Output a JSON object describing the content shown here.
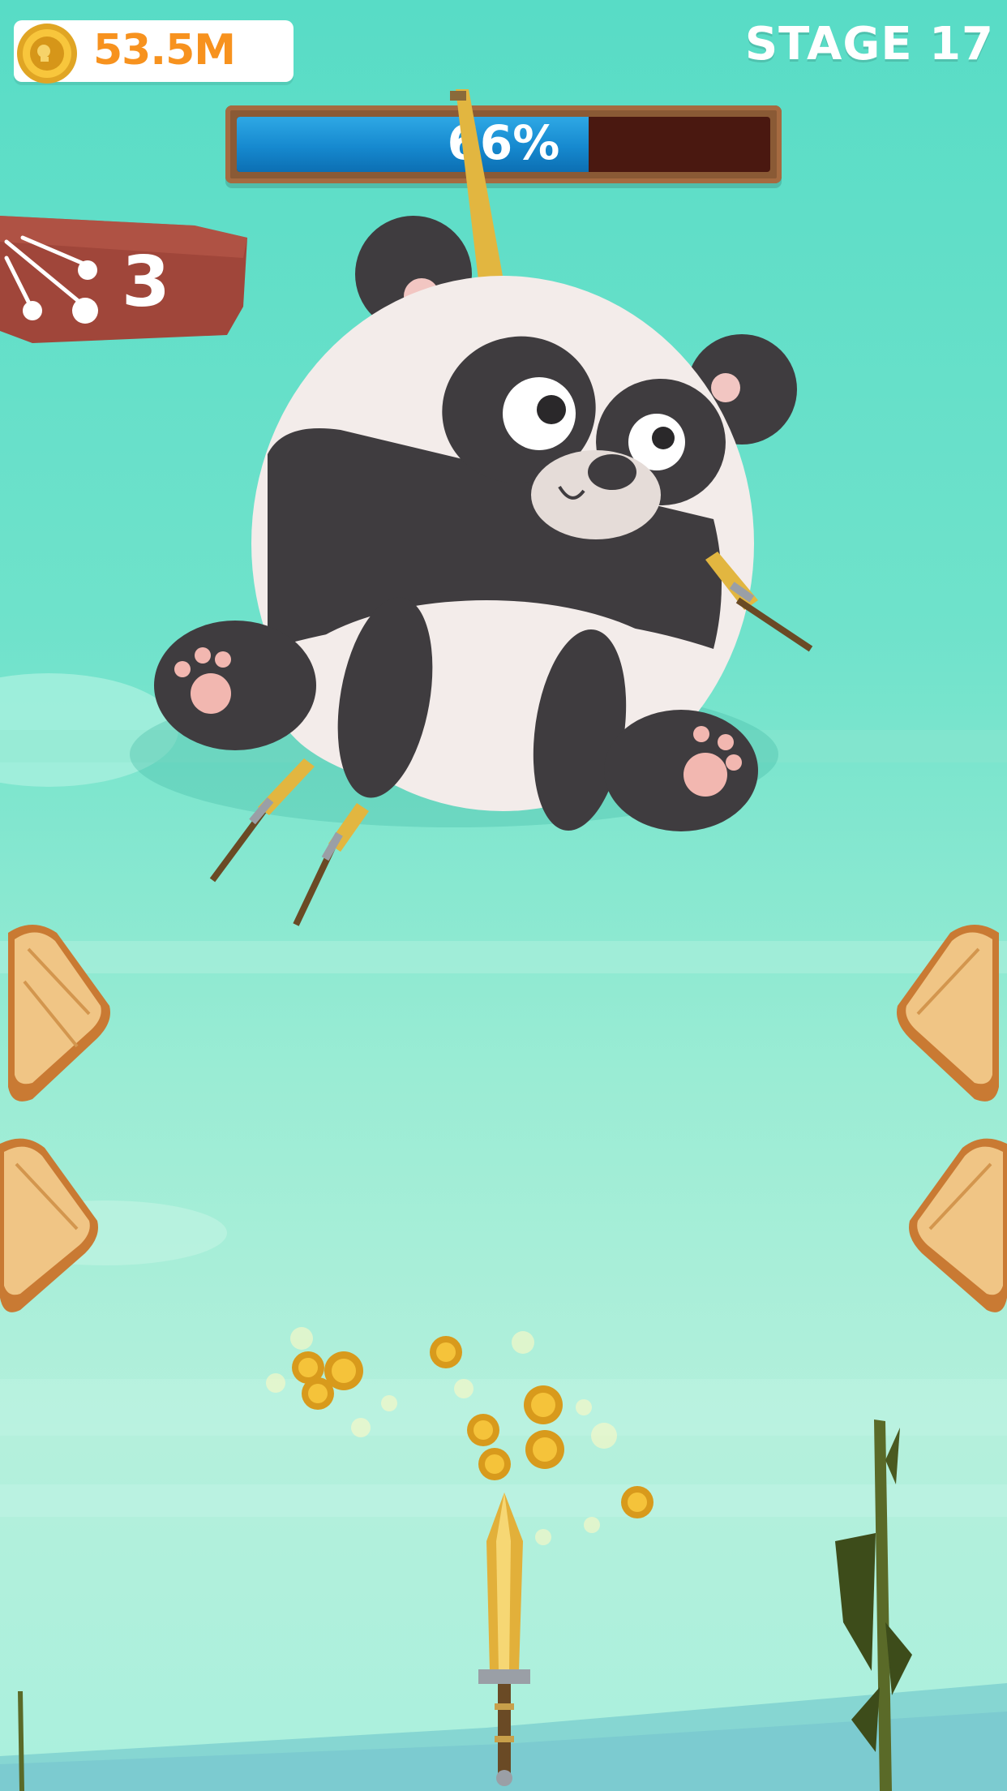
{
  "hud": {
    "coins": "53.5M",
    "stage": "STAGE 17"
  },
  "progress": {
    "percent_label": "66%",
    "fraction": 0.66
  },
  "knives_remaining": "3",
  "scene": {
    "target": "panda",
    "stuck_knives": 4,
    "ledges": 4,
    "flying_coins": 10
  },
  "colors": {
    "sky_top": "#58dcc6",
    "sky_bottom": "#aaf0dd",
    "coin_text": "#f7921e",
    "progress_fill": "#1689cf",
    "wood": "#a0463a"
  }
}
